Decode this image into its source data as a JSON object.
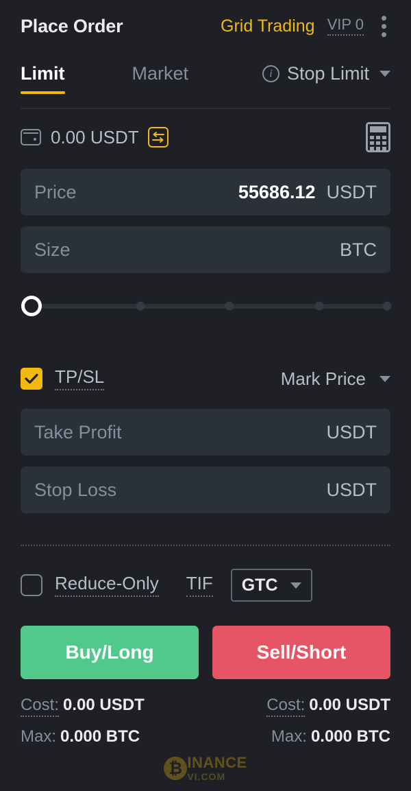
{
  "header": {
    "title": "Place Order",
    "grid_trading": "Grid Trading",
    "vip": "VIP 0",
    "menu_icon": "kebab-menu-icon"
  },
  "tabs": [
    {
      "label": "Limit",
      "active": true
    },
    {
      "label": "Market",
      "active": false
    },
    {
      "label": "Stop Limit",
      "active": false
    }
  ],
  "balance": {
    "wallet_icon": "wallet-icon",
    "amount": "0.00 USDT",
    "swap_icon": "swap-arrows-icon",
    "calculator_icon": "calculator-icon"
  },
  "price_field": {
    "label": "Price",
    "value": "55686.12",
    "unit": "USDT"
  },
  "size_field": {
    "label": "Size",
    "value": "",
    "unit": "BTC"
  },
  "slider": {
    "value": 0,
    "steps": [
      0,
      25,
      50,
      75,
      100
    ]
  },
  "tpsl": {
    "checked": true,
    "label": "TP/SL",
    "trigger": "Mark Price"
  },
  "take_profit": {
    "label": "Take Profit",
    "value": "",
    "unit": "USDT"
  },
  "stop_loss": {
    "label": "Stop Loss",
    "value": "",
    "unit": "USDT"
  },
  "reduce_only": {
    "checked": false,
    "label": "Reduce-Only"
  },
  "tif": {
    "label": "TIF",
    "value": "GTC"
  },
  "actions": {
    "buy": "Buy/Long",
    "sell": "Sell/Short"
  },
  "stats": {
    "buy_cost_key": "Cost:",
    "buy_cost_val": "0.00 USDT",
    "buy_max_key": "Max:",
    "buy_max_val": "0.000 BTC",
    "sell_cost_key": "Cost:",
    "sell_cost_val": "0.00 USDT",
    "sell_max_key": "Max:",
    "sell_max_val": "0.000 BTC"
  },
  "watermark": {
    "symbol": "₿",
    "main": "INANCE",
    "sub": "VI.COM"
  },
  "colors": {
    "background": "#1e2026",
    "field": "#2b3139",
    "accent": "#f0b90b",
    "buy": "#50c98a",
    "sell": "#e65565",
    "text_primary": "#eaecef",
    "text_muted": "#848e9c"
  }
}
